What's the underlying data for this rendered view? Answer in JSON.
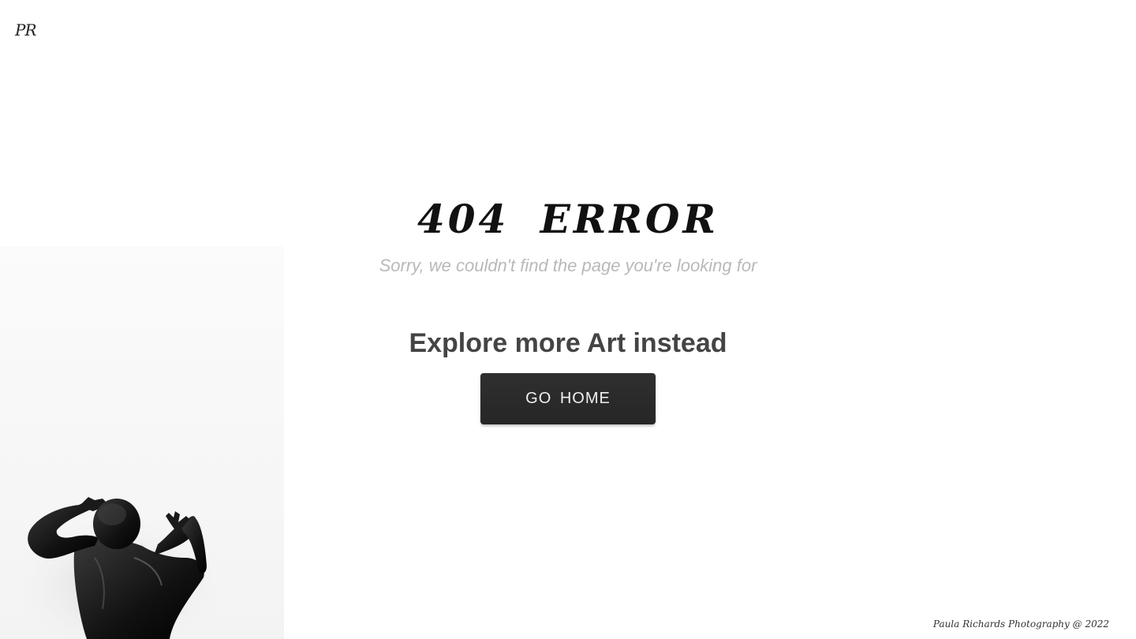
{
  "header": {
    "logo_text": "PR"
  },
  "main": {
    "title": "404 ERROR",
    "subtitle": "Sorry, we couldn't find the page you're looking for",
    "explore_heading": "Explore more Art instead",
    "home_button_label": "GO HOME"
  },
  "footer": {
    "copyright": "Paula Richards Photography @ 2022"
  },
  "colors": {
    "button_bg": "#2b2b2b",
    "subtitle": "#b9b9b9",
    "heading": "#444444"
  }
}
